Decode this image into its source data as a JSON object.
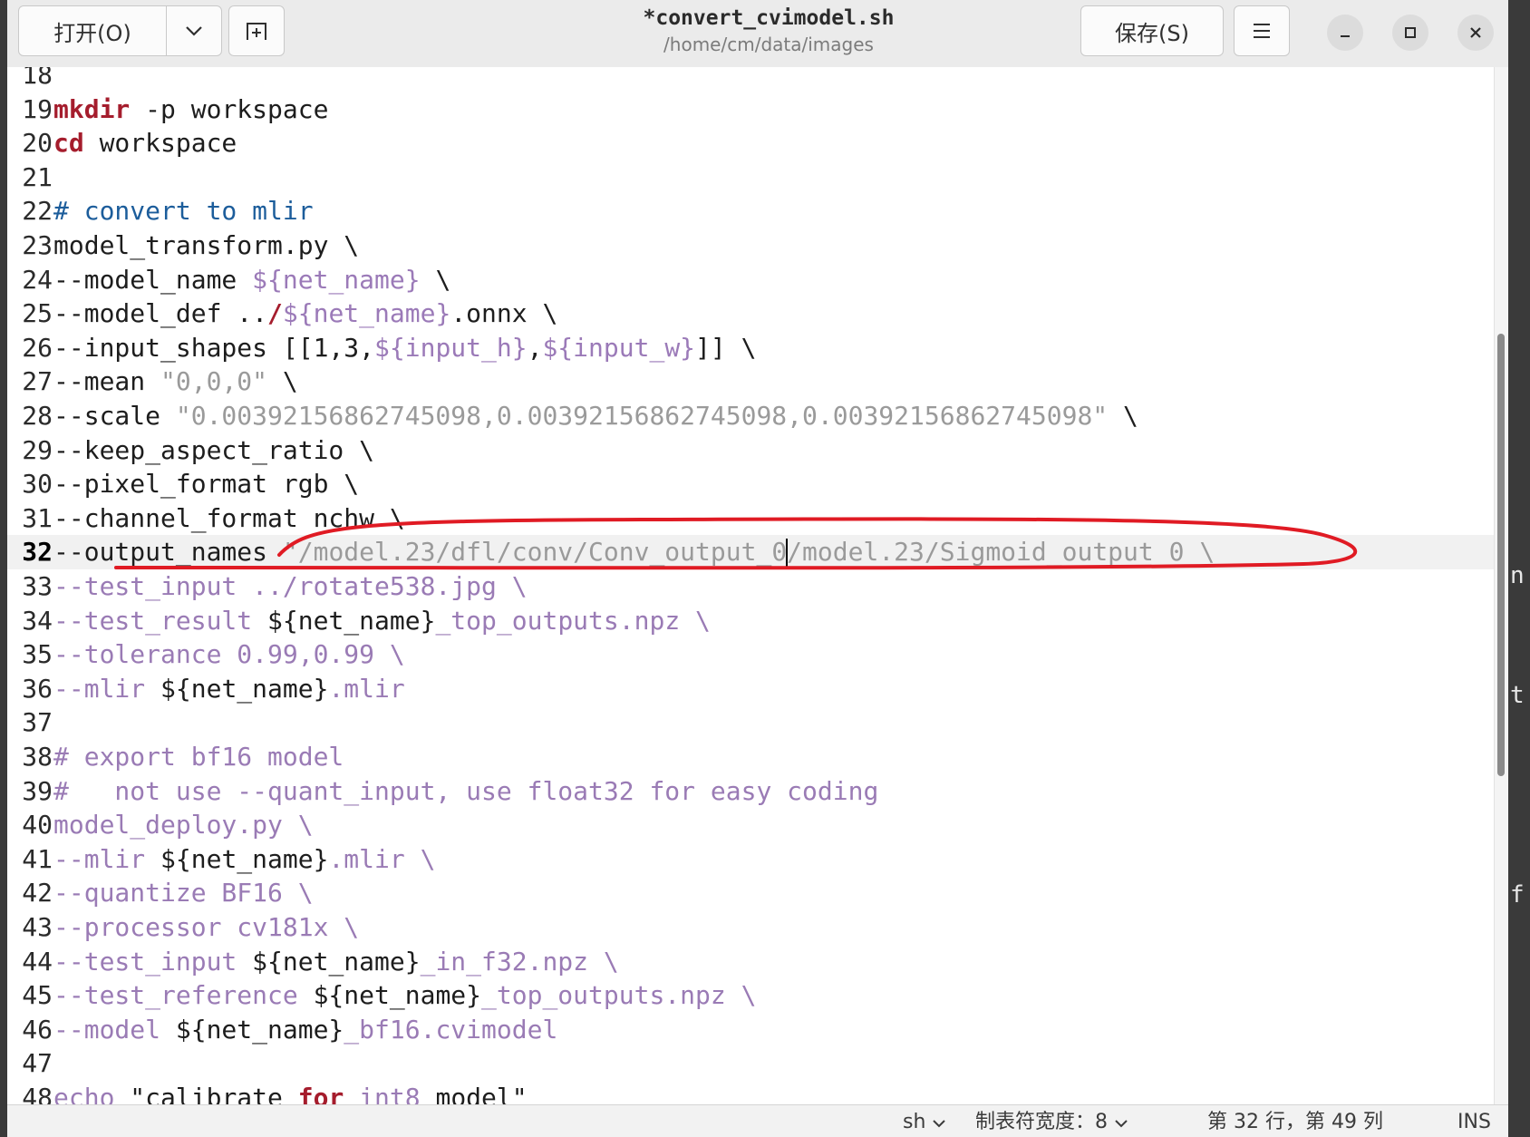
{
  "header": {
    "open_label": "打开(O)",
    "open_menu_icon": "chevron-down-icon",
    "new_tab_icon": "new-tab-icon",
    "title": "*convert_cvimodel.sh",
    "subtitle": "/home/cm/data/images",
    "save_label": "保存(S)",
    "menu_icon": "hamburger-menu-icon",
    "minimize_icon": "minimize-icon",
    "maximize_icon": "maximize-icon",
    "close_icon": "close-icon"
  },
  "editor": {
    "current_line": 32,
    "lines": [
      {
        "n": "18",
        "segs": []
      },
      {
        "n": "19",
        "segs": [
          {
            "t": "mkdir",
            "c": "kw"
          },
          {
            "t": " -p workspace",
            "c": ""
          }
        ]
      },
      {
        "n": "20",
        "segs": [
          {
            "t": "cd",
            "c": "kw"
          },
          {
            "t": " workspace",
            "c": ""
          }
        ]
      },
      {
        "n": "21",
        "segs": []
      },
      {
        "n": "22",
        "segs": [
          {
            "t": "# convert to mlir",
            "c": "cm"
          }
        ]
      },
      {
        "n": "23",
        "segs": [
          {
            "t": "model_transform.py \\",
            "c": ""
          }
        ]
      },
      {
        "n": "24",
        "segs": [
          {
            "t": "--model_name ",
            "c": ""
          },
          {
            "t": "${",
            "c": "var"
          },
          {
            "t": "net_name",
            "c": "var"
          },
          {
            "t": "}",
            "c": "var"
          },
          {
            "t": " \\",
            "c": ""
          }
        ]
      },
      {
        "n": "25",
        "segs": [
          {
            "t": "--model_def ..",
            "c": ""
          },
          {
            "t": "/",
            "c": "kw"
          },
          {
            "t": "${",
            "c": "var"
          },
          {
            "t": "net_name",
            "c": "var"
          },
          {
            "t": "}",
            "c": "var"
          },
          {
            "t": ".onnx \\",
            "c": ""
          }
        ]
      },
      {
        "n": "26",
        "segs": [
          {
            "t": "--input_shapes [[1,3,",
            "c": ""
          },
          {
            "t": "${input_h}",
            "c": "var"
          },
          {
            "t": ",",
            "c": ""
          },
          {
            "t": "${input_w}",
            "c": "var"
          },
          {
            "t": "]] \\",
            "c": ""
          }
        ]
      },
      {
        "n": "27",
        "segs": [
          {
            "t": "--mean ",
            "c": ""
          },
          {
            "t": "\"0,0,0\"",
            "c": "str"
          },
          {
            "t": " \\",
            "c": ""
          }
        ]
      },
      {
        "n": "28",
        "segs": [
          {
            "t": "--scale ",
            "c": ""
          },
          {
            "t": "\"0.0039215686274509​8,0.0039215686274509​8,0.0039215686274509​8\"",
            "c": "str"
          },
          {
            "t": " \\",
            "c": ""
          }
        ]
      },
      {
        "n": "29",
        "segs": [
          {
            "t": "--keep_aspect_ratio \\",
            "c": ""
          }
        ]
      },
      {
        "n": "30",
        "segs": [
          {
            "t": "--pixel_format rgb \\",
            "c": ""
          }
        ]
      },
      {
        "n": "31",
        "segs": [
          {
            "t": "--channel_format nchw \\",
            "c": ""
          }
        ]
      },
      {
        "n": "32",
        "segs": [
          {
            "t": "--output_names ",
            "c": ""
          },
          {
            "t": "\"/model.23/dfl/conv/Conv_output_0",
            "c": "str"
          },
          {
            "t": "CARET",
            "c": "caret"
          },
          {
            "t": "/model.23/Sigmoid_output_0 \\",
            "c": "str"
          }
        ]
      },
      {
        "n": "33",
        "segs": [
          {
            "t": "--test_input ../rotate538.jpg \\",
            "c": "faint"
          }
        ]
      },
      {
        "n": "34",
        "segs": [
          {
            "t": "--test_result ",
            "c": "faint"
          },
          {
            "t": "${net_name}",
            "c": ""
          },
          {
            "t": "_top_outputs.npz \\",
            "c": "faint"
          }
        ]
      },
      {
        "n": "35",
        "segs": [
          {
            "t": "--tolerance 0.99,0.99 \\",
            "c": "faint"
          }
        ]
      },
      {
        "n": "36",
        "segs": [
          {
            "t": "--mlir ",
            "c": "faint"
          },
          {
            "t": "${net_name}",
            "c": ""
          },
          {
            "t": ".mlir",
            "c": "faint"
          }
        ]
      },
      {
        "n": "37",
        "segs": []
      },
      {
        "n": "38",
        "segs": [
          {
            "t": "# export bf16 model",
            "c": "faint"
          }
        ]
      },
      {
        "n": "39",
        "segs": [
          {
            "t": "#   not use --quant_input, use float32 for easy coding",
            "c": "faint"
          }
        ]
      },
      {
        "n": "40",
        "segs": [
          {
            "t": "model_deploy.py \\",
            "c": "faint"
          }
        ]
      },
      {
        "n": "41",
        "segs": [
          {
            "t": "--mlir ",
            "c": "faint"
          },
          {
            "t": "${net_name}",
            "c": ""
          },
          {
            "t": ".mlir \\",
            "c": "faint"
          }
        ]
      },
      {
        "n": "42",
        "segs": [
          {
            "t": "--quantize BF16 \\",
            "c": "faint"
          }
        ]
      },
      {
        "n": "43",
        "segs": [
          {
            "t": "--processor cv181x \\",
            "c": "faint"
          }
        ]
      },
      {
        "n": "44",
        "segs": [
          {
            "t": "--test_input ",
            "c": "faint"
          },
          {
            "t": "${net_name}",
            "c": ""
          },
          {
            "t": "_in_f32.npz \\",
            "c": "faint"
          }
        ]
      },
      {
        "n": "45",
        "segs": [
          {
            "t": "--test_reference ",
            "c": "faint"
          },
          {
            "t": "${net_name}",
            "c": ""
          },
          {
            "t": "_top_outputs.npz \\",
            "c": "faint"
          }
        ]
      },
      {
        "n": "46",
        "segs": [
          {
            "t": "--model ",
            "c": "faint"
          },
          {
            "t": "${net_name}",
            "c": ""
          },
          {
            "t": "_bf16.cvimodel",
            "c": "faint"
          }
        ]
      },
      {
        "n": "47",
        "segs": []
      },
      {
        "n": "48",
        "segs": [
          {
            "t": "echo",
            "c": "faint"
          },
          {
            "t": " \"calibrate ",
            "c": ""
          },
          {
            "t": "for",
            "c": "kw"
          },
          {
            "t": " int8",
            "c": "faint"
          },
          {
            "t": " model\"",
            "c": ""
          }
        ]
      }
    ]
  },
  "statusbar": {
    "language": "sh",
    "tab_width": "制表符宽度：8",
    "position": "第 32 行，第 49 列",
    "mode": "INS"
  },
  "background_chars": [
    "n",
    "t",
    "f"
  ],
  "colors": {
    "keyword": "#a51d2d",
    "comment": "#1c5d9b",
    "string": "#9a9a9a",
    "annotation": "#e01b24"
  }
}
